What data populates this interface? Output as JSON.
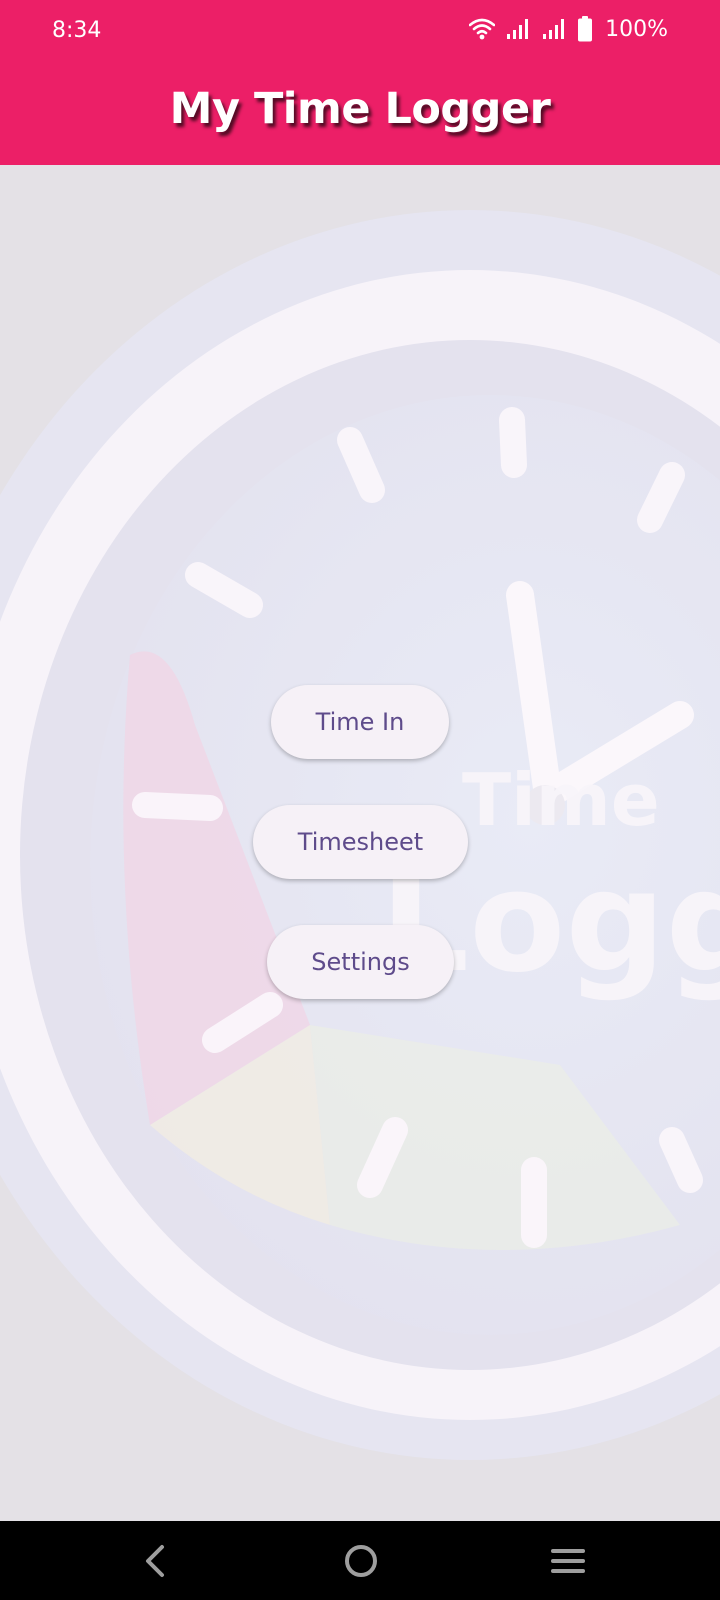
{
  "status_bar": {
    "time": "8:34",
    "battery": "100%",
    "icons": [
      "wifi-icon",
      "signal-icon",
      "signal-icon",
      "battery-icon"
    ]
  },
  "header": {
    "title": "My Time Logger",
    "background_color": "#ec1f67"
  },
  "background_logo": {
    "text_line1": "Time",
    "text_line2": "Logger"
  },
  "menu": {
    "buttons": [
      {
        "label": "Time In"
      },
      {
        "label": "Timesheet"
      },
      {
        "label": "Settings"
      }
    ],
    "button_text_color": "#5e4b8b",
    "button_bg_color": "#f6f1f7"
  },
  "nav_bar": {
    "icons": [
      "back-icon",
      "home-icon",
      "recents-icon"
    ]
  }
}
